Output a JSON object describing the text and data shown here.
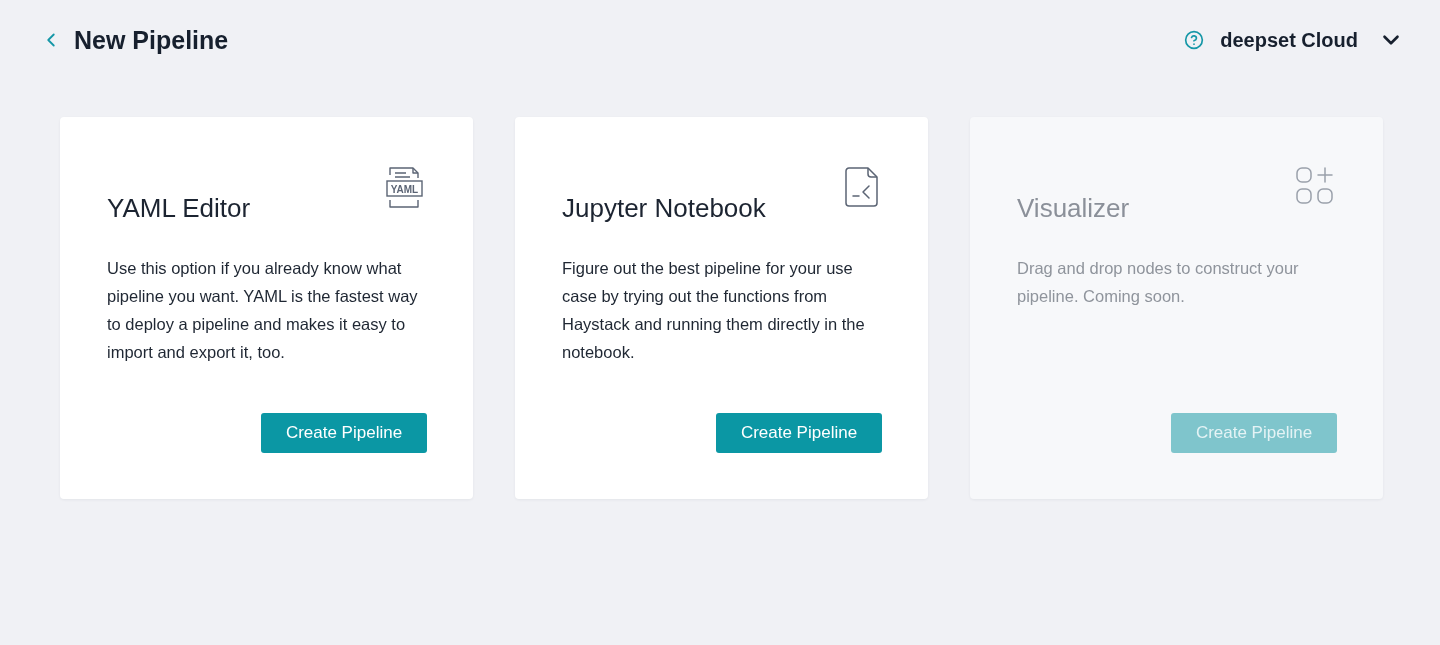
{
  "header": {
    "title": "New Pipeline"
  },
  "account_menu": {
    "label": "deepset Cloud"
  },
  "cards": [
    {
      "kind": "yaml",
      "title": "YAML Editor",
      "icon_label": "YAML",
      "description": "Use this option if you already know what pipeline you want. YAML is the fastest way to deploy a pipeline and makes it easy to import and export it, too.",
      "button": "Create Pipeline",
      "disabled": false
    },
    {
      "kind": "notebook",
      "title": "Jupyter Notebook",
      "description": "Figure out the best pipeline for your use case by trying out the functions from Haystack and running them directly in the notebook.",
      "button": "Create Pipeline",
      "disabled": false
    },
    {
      "kind": "visualizer",
      "title": "Visualizer",
      "description": "Drag and drop nodes to construct your pipeline. Coming soon.",
      "button": "Create Pipeline",
      "disabled": true
    }
  ]
}
